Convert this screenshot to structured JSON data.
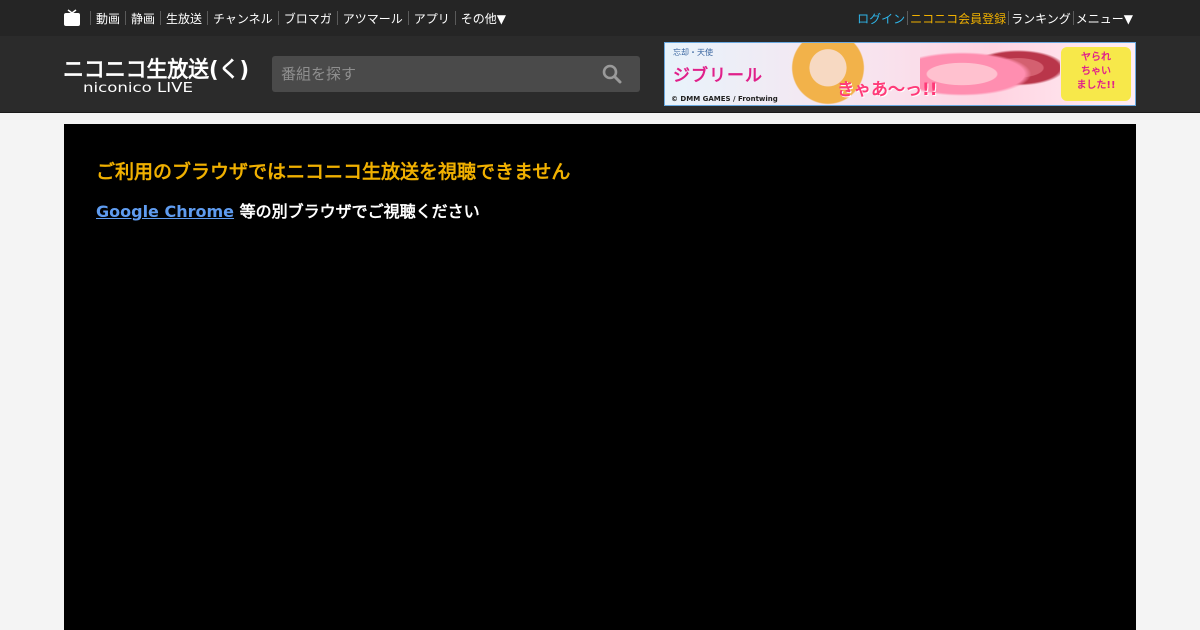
{
  "topnav": {
    "items": [
      "動画",
      "静画",
      "生放送",
      "チャンネル",
      "ブロマガ",
      "アツマール",
      "アプリ",
      "その他▼"
    ],
    "right": {
      "login": "ログイン",
      "register": "ニコニコ会員登録",
      "ranking": "ランキング",
      "menu": "メニュー▼"
    }
  },
  "header": {
    "logo_text": "ニコニコ生放送(く)",
    "logo_sub": "niconico LIVE",
    "search_placeholder": "番組を探す"
  },
  "banner": {
    "subtitle": "忘却・天使",
    "title": "ジブリール",
    "shout": "きゃあ〜っ!!",
    "badge": "ヤられ\nちゃい\nました!!",
    "credit": "© DMM GAMES / Frontwing"
  },
  "player": {
    "title": "ご利用のブラウザではニコニコ生放送を視聴できません",
    "link": "Google Chrome",
    "suffix": " 等の別ブラウザでご視聴ください"
  },
  "colors": {
    "accent": "#f0b000",
    "login": "#2fb6ea",
    "link": "#5f9cf0"
  }
}
